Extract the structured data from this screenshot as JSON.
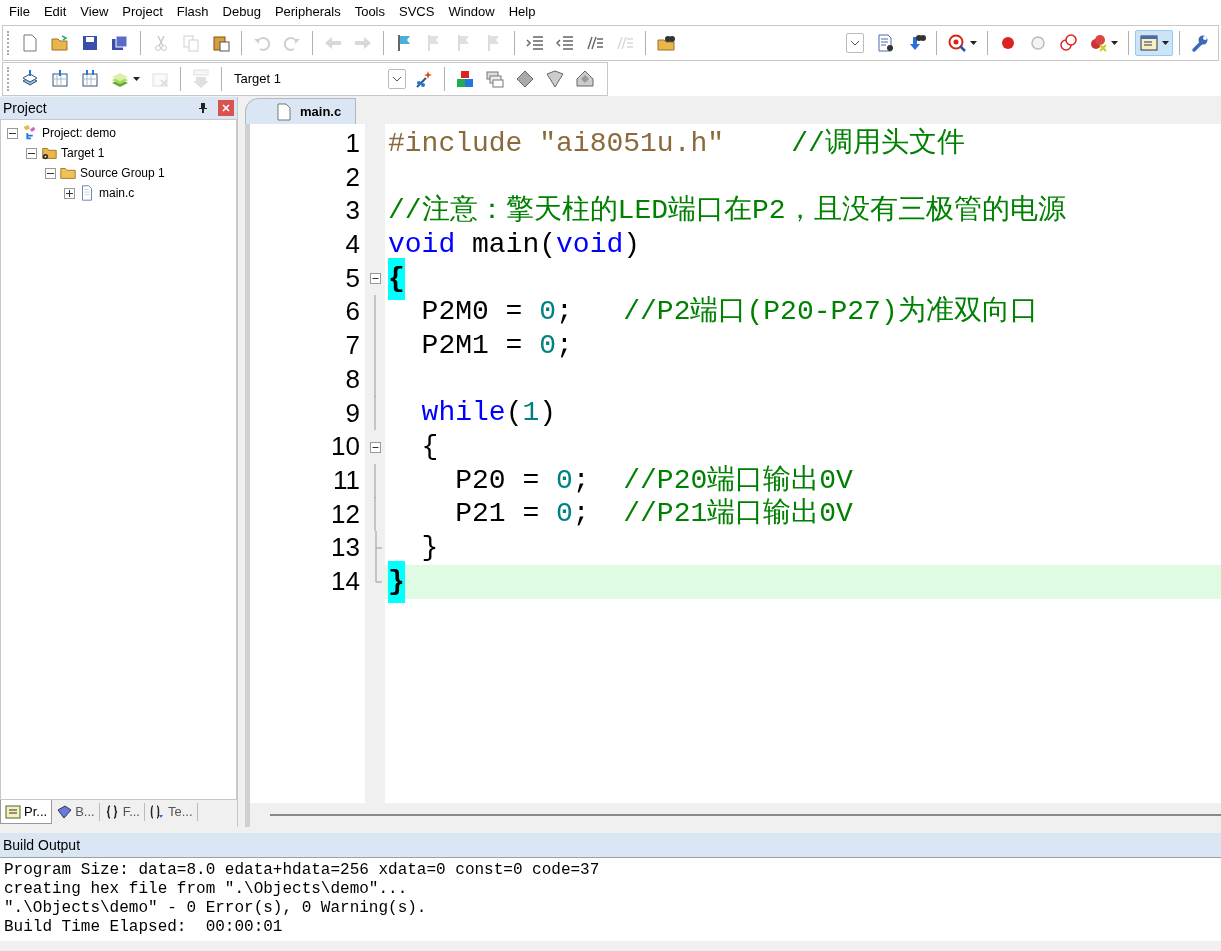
{
  "menu": [
    "File",
    "Edit",
    "View",
    "Project",
    "Flash",
    "Debug",
    "Peripherals",
    "Tools",
    "SVCS",
    "Window",
    "Help"
  ],
  "toolbar_main": [
    {
      "kind": "new",
      "disabled": false,
      "pressed": false
    },
    {
      "kind": "open",
      "disabled": false,
      "pressed": false
    },
    {
      "kind": "save",
      "disabled": false,
      "pressed": false
    },
    {
      "kind": "save-all",
      "disabled": false,
      "pressed": false
    },
    {
      "kind": "sep"
    },
    {
      "kind": "cut",
      "disabled": true,
      "pressed": false
    },
    {
      "kind": "copy",
      "disabled": true,
      "pressed": false
    },
    {
      "kind": "paste",
      "disabled": false,
      "pressed": false
    },
    {
      "kind": "sep"
    },
    {
      "kind": "undo",
      "disabled": true,
      "pressed": false
    },
    {
      "kind": "redo",
      "disabled": true,
      "pressed": false
    },
    {
      "kind": "sep"
    },
    {
      "kind": "back",
      "disabled": true,
      "pressed": false
    },
    {
      "kind": "forward",
      "disabled": true,
      "pressed": false
    },
    {
      "kind": "sep"
    },
    {
      "kind": "bookmark",
      "disabled": false,
      "pressed": false
    },
    {
      "kind": "bookmark-prev",
      "disabled": true,
      "pressed": false
    },
    {
      "kind": "bookmark-next",
      "disabled": true,
      "pressed": false
    },
    {
      "kind": "bookmark-clear",
      "disabled": true,
      "pressed": false
    },
    {
      "kind": "sep"
    },
    {
      "kind": "indent",
      "disabled": false,
      "pressed": false
    },
    {
      "kind": "unindent",
      "disabled": false,
      "pressed": false
    },
    {
      "kind": "comment",
      "disabled": false,
      "pressed": false
    },
    {
      "kind": "uncomment",
      "disabled": true,
      "pressed": false
    },
    {
      "kind": "sep"
    },
    {
      "kind": "find-in-files",
      "disabled": false,
      "pressed": false
    },
    {
      "kind": "spacer"
    },
    {
      "kind": "combo"
    },
    {
      "kind": "find",
      "disabled": false,
      "pressed": false
    },
    {
      "kind": "incremental-find",
      "disabled": false,
      "pressed": false
    },
    {
      "kind": "sep"
    },
    {
      "kind": "debug",
      "disabled": false,
      "pressed": false,
      "dropdown": true
    },
    {
      "kind": "sep"
    },
    {
      "kind": "breakpoint",
      "disabled": false,
      "pressed": false
    },
    {
      "kind": "breakpoint-disable",
      "disabled": false,
      "pressed": false
    },
    {
      "kind": "breakpoint-disable-all",
      "disabled": false,
      "pressed": false
    },
    {
      "kind": "breakpoint-kill",
      "disabled": false,
      "pressed": false,
      "dropdown": true
    },
    {
      "kind": "sep"
    },
    {
      "kind": "window",
      "disabled": false,
      "pressed": true,
      "dropdown": true
    },
    {
      "kind": "sep"
    },
    {
      "kind": "configure",
      "disabled": false,
      "pressed": false
    }
  ],
  "toolbar_build": [
    {
      "kind": "translate",
      "disabled": false,
      "pressed": false
    },
    {
      "kind": "build",
      "disabled": false,
      "pressed": false
    },
    {
      "kind": "rebuild",
      "disabled": false,
      "pressed": false
    },
    {
      "kind": "batch",
      "disabled": false,
      "pressed": false,
      "dropdown": true
    },
    {
      "kind": "stop",
      "disabled": true,
      "pressed": false
    },
    {
      "kind": "sep"
    },
    {
      "kind": "load",
      "disabled": true,
      "pressed": false
    },
    {
      "kind": "sep"
    },
    {
      "kind": "target",
      "value": "Target 1"
    },
    {
      "kind": "options",
      "disabled": false,
      "pressed": false
    },
    {
      "kind": "sep"
    },
    {
      "kind": "components",
      "disabled": false,
      "pressed": false
    },
    {
      "kind": "items",
      "disabled": false,
      "pressed": false
    },
    {
      "kind": "pack-select",
      "disabled": false,
      "pressed": false
    },
    {
      "kind": "pack-installer",
      "disabled": false,
      "pressed": false
    },
    {
      "kind": "pack-manage",
      "disabled": false,
      "pressed": false
    }
  ],
  "project_panel": {
    "title": "Project",
    "tree": [
      {
        "label": "Project: demo",
        "kind": "project",
        "expanded": true,
        "children": [
          {
            "label": "Target 1",
            "kind": "target",
            "expanded": true,
            "children": [
              {
                "label": "Source Group 1",
                "kind": "group",
                "expanded": true,
                "children": [
                  {
                    "label": "main.c",
                    "kind": "file",
                    "expanded": false
                  }
                ]
              }
            ]
          }
        ]
      }
    ],
    "tabs": [
      {
        "label": "Pr...",
        "kind": "project",
        "selected": true
      },
      {
        "label": "B...",
        "kind": "books",
        "selected": false
      },
      {
        "label": "F...",
        "kind": "functions",
        "selected": false
      },
      {
        "label": "Te...",
        "kind": "templates",
        "selected": false
      }
    ]
  },
  "editor": {
    "tabs": [
      {
        "label": "main.c",
        "selected": true
      }
    ],
    "lines": [
      {
        "number": "1",
        "fold_open": false,
        "fold_end": false,
        "current": false,
        "tokens": [
          {
            "kind": "keyword_pre",
            "text": "#include "
          },
          {
            "kind": "string",
            "text": "\"ai8051u.h\"    "
          },
          {
            "kind": "comment",
            "text": "//调用头文件"
          }
        ]
      },
      {
        "number": "2",
        "fold_open": false,
        "fold_end": false,
        "current": false
      },
      {
        "number": "3",
        "fold_open": false,
        "fold_end": false,
        "current": false,
        "tokens": [
          {
            "kind": "comment",
            "text": "//注意：擎天柱的LED端口在P2，且没有三极管的电源"
          }
        ]
      },
      {
        "number": "4",
        "fold_open": false,
        "fold_end": false,
        "current": false,
        "tokens": [
          {
            "kind": "keyword",
            "text": "void"
          },
          {
            "kind": "plain",
            "text": " main("
          },
          {
            "kind": "keyword",
            "text": "void"
          },
          {
            "kind": "plain",
            "text": ")"
          }
        ]
      },
      {
        "number": "5",
        "fold_open": true,
        "fold_end": false,
        "current": false,
        "tokens": [
          {
            "kind": "brace_match",
            "text": "{"
          }
        ]
      },
      {
        "number": "6",
        "fold_open": false,
        "fold_end": false,
        "current": false,
        "tokens": [
          {
            "kind": "plain",
            "text": "  P2M0 = "
          },
          {
            "kind": "number",
            "text": "0"
          },
          {
            "kind": "plain",
            "text": ";   "
          },
          {
            "kind": "comment",
            "text": "//P2端口(P20-P27)为准双向口"
          }
        ]
      },
      {
        "number": "7",
        "fold_open": false,
        "fold_end": false,
        "current": false,
        "tokens": [
          {
            "kind": "plain",
            "text": "  P2M1 = "
          },
          {
            "kind": "number",
            "text": "0"
          },
          {
            "kind": "plain",
            "text": ";"
          }
        ]
      },
      {
        "number": "8",
        "fold_open": false,
        "fold_end": false,
        "current": false
      },
      {
        "number": "9",
        "fold_open": false,
        "fold_end": false,
        "current": false,
        "tokens": [
          {
            "kind": "keyword",
            "text": "  while"
          },
          {
            "kind": "plain",
            "text": "("
          },
          {
            "kind": "number",
            "text": "1"
          },
          {
            "kind": "plain",
            "text": ")"
          }
        ]
      },
      {
        "number": "10",
        "fold_open": true,
        "fold_end": false,
        "current": false,
        "tokens": [
          {
            "kind": "plain",
            "text": "  {"
          }
        ]
      },
      {
        "number": "11",
        "fold_open": false,
        "fold_end": false,
        "current": false,
        "tokens": [
          {
            "kind": "plain",
            "text": "    P20 = "
          },
          {
            "kind": "number",
            "text": "0"
          },
          {
            "kind": "plain",
            "text": ";  "
          },
          {
            "kind": "comment",
            "text": "//P20端口输出0V"
          }
        ]
      },
      {
        "number": "12",
        "fold_open": false,
        "fold_end": false,
        "current": false,
        "tokens": [
          {
            "kind": "plain",
            "text": "    P21 = "
          },
          {
            "kind": "number",
            "text": "0"
          },
          {
            "kind": "plain",
            "text": ";  "
          },
          {
            "kind": "comment",
            "text": "//P21端口输出0V"
          }
        ]
      },
      {
        "number": "13",
        "fold_open": false,
        "fold_end": true,
        "current": false,
        "tokens": [
          {
            "kind": "plain",
            "text": "  }"
          }
        ]
      },
      {
        "number": "14",
        "fold_open": false,
        "fold_end": true,
        "current": true,
        "tokens": [
          {
            "kind": "brace_match",
            "text": "}"
          }
        ]
      }
    ]
  },
  "build_output": {
    "title": "Build Output",
    "lines": [
      "Program Size: data=8.0 edata+hdata=256 xdata=0 const=0 code=37",
      "creating hex file from \".\\Objects\\demo\"...",
      "\".\\Objects\\demo\" - 0 Error(s), 0 Warning(s).",
      "Build Time Elapsed:  00:00:01"
    ]
  }
}
